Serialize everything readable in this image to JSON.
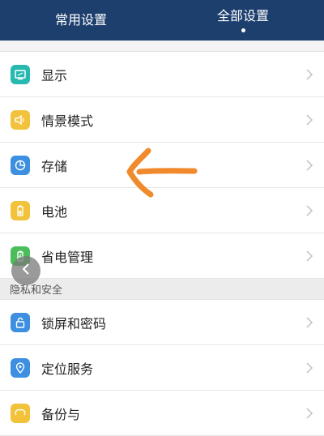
{
  "header": {
    "tabs": [
      {
        "label": "常用设置",
        "active": false
      },
      {
        "label": "全部设置",
        "active": true
      }
    ],
    "background": "#1d3f6e"
  },
  "rows_group1": [
    {
      "label": "显示",
      "icon": "display-icon",
      "color": "#27b9b0"
    },
    {
      "label": "情景模式",
      "icon": "speaker-icon",
      "color": "#f2c23a"
    },
    {
      "label": "存储",
      "icon": "storage-pie-icon",
      "color": "#3d8fe0"
    },
    {
      "label": "电池",
      "icon": "battery-icon",
      "color": "#f2c23a"
    },
    {
      "label": "省电管理",
      "icon": "power-save-icon",
      "color": "#4bbd5d"
    }
  ],
  "section": {
    "label": "隐私和安全"
  },
  "rows_group2": [
    {
      "label": "锁屏和密码",
      "icon": "lock-icon",
      "color": "#3d8fe0"
    },
    {
      "label": "定位服务",
      "icon": "location-icon",
      "color": "#3d8fe0"
    },
    {
      "label": "备份与",
      "icon": "backup-icon",
      "color": "#f2c23a"
    }
  ],
  "annotation": {
    "color": "#f08a2c",
    "icon": "arrow-annotation-icon"
  }
}
